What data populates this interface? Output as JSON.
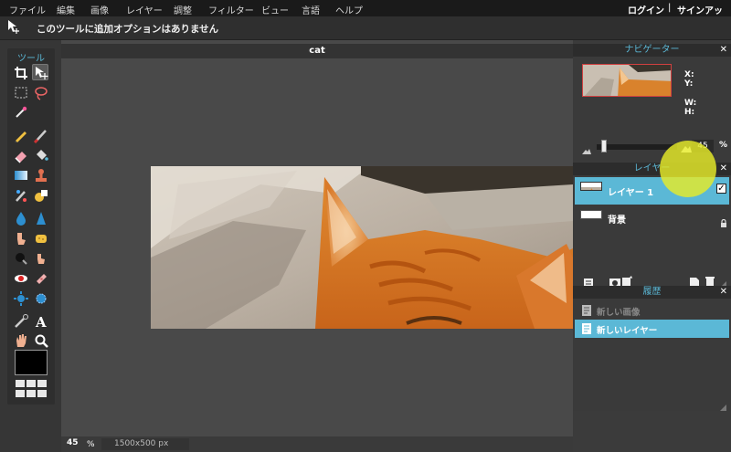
{
  "menu": {
    "items": [
      "ファイル",
      "編集",
      "画像",
      "レイヤー",
      "調整",
      "フィルター",
      "ビュー",
      "言語",
      "ヘルプ"
    ],
    "login": "ログイン",
    "separator": "|",
    "signup": "サインアップ"
  },
  "options": {
    "message": "このツールに追加オプションはありません",
    "tool_icon": "move-tool-icon"
  },
  "tools": {
    "title": "ツール",
    "icons": [
      "crop-icon",
      "move-icon",
      "marquee-icon",
      "lasso-icon",
      "magic-wand-icon",
      "pencil-icon",
      "brush-icon",
      "eraser-icon",
      "bucket-icon",
      "gradient-icon",
      "clone-stamp-icon",
      "color-replace-icon",
      "drawing-icon",
      "blur-icon",
      "sharpen-icon",
      "smudge-icon",
      "sponge-icon",
      "burn-icon",
      "dodge-icon",
      "red-eye-icon",
      "spot-heal-icon",
      "bloat-icon",
      "pinch-icon",
      "color-picker-icon",
      "type-icon",
      "hand-icon",
      "zoom-icon"
    ]
  },
  "document": {
    "title": "cat"
  },
  "status": {
    "zoom": "45",
    "zoom_unit": "%",
    "dimensions": "1500x500 px"
  },
  "navigator": {
    "title": "ナビゲーター",
    "x_label": "X:",
    "y_label": "Y:",
    "w_label": "W:",
    "h_label": "H:",
    "zoom_value": "45",
    "zoom_unit": "%",
    "zoom_level": 0.45
  },
  "layers": {
    "title": "レイヤー",
    "items": [
      {
        "name": "レイヤー 1",
        "selected": true,
        "visible": true
      },
      {
        "name": "背景",
        "selected": false,
        "locked": true
      }
    ]
  },
  "history": {
    "title": "履歴",
    "items": [
      {
        "label": "新しい画像",
        "selected": false
      },
      {
        "label": "新しいレイヤー",
        "selected": true
      }
    ]
  },
  "colors": {
    "accent": "#5bb8d6",
    "foreground": "#000000"
  }
}
